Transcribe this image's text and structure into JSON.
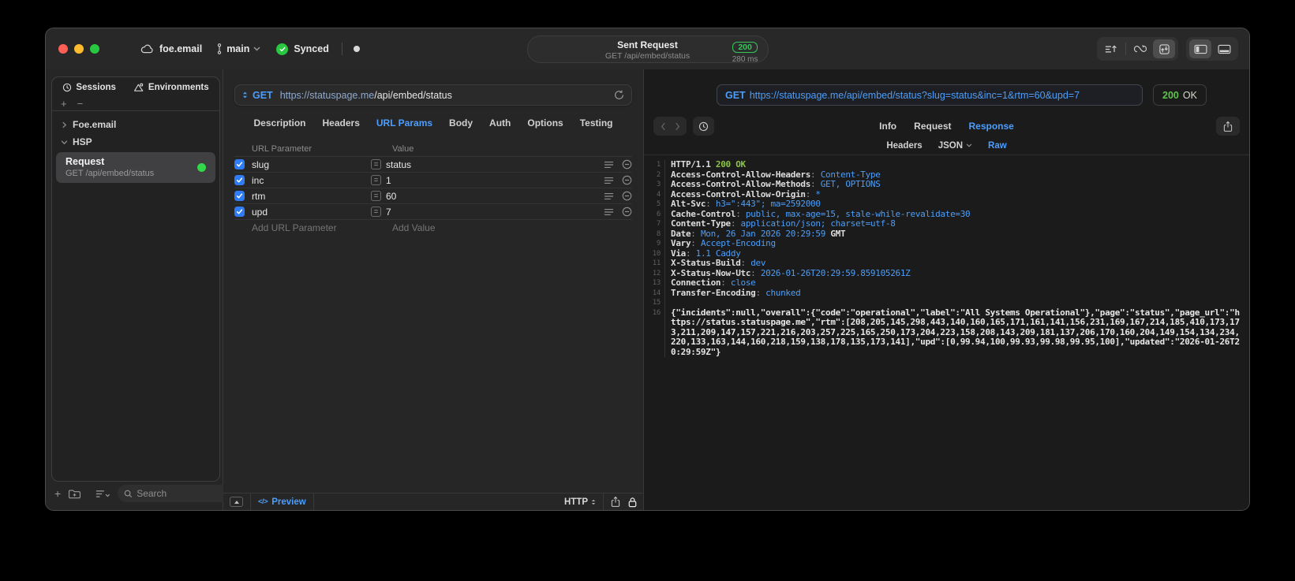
{
  "titlebar": {
    "project": "foe.email",
    "branch": "main",
    "sync_status": "Synced",
    "request_summary": {
      "title": "Sent Request",
      "method_path": "GET /api/embed/status",
      "status_code": "200",
      "duration": "280 ms"
    }
  },
  "sidebar": {
    "tabs": [
      {
        "label": "Sessions"
      },
      {
        "label": "Environments"
      }
    ],
    "groups": [
      {
        "label": "Foe.email",
        "expanded": false
      },
      {
        "label": "HSP",
        "expanded": true
      }
    ],
    "request_item": {
      "title": "Request",
      "subtitle": "GET /api/embed/status",
      "selected": true,
      "status_dot": "green"
    },
    "search_placeholder": "Search"
  },
  "request_pane": {
    "method": "GET",
    "url_domain": "https://statuspage.me",
    "url_path": "/api/embed/status",
    "tabs": [
      "Description",
      "Headers",
      "URL Params",
      "Body",
      "Auth",
      "Options",
      "Testing"
    ],
    "active_tab": "URL Params",
    "params_table": {
      "columns": [
        "URL Parameter",
        "Value"
      ],
      "rows": [
        {
          "enabled": true,
          "name": "slug",
          "value": "status"
        },
        {
          "enabled": true,
          "name": "inc",
          "value": "1"
        },
        {
          "enabled": true,
          "name": "rtm",
          "value": "60"
        },
        {
          "enabled": true,
          "name": "upd",
          "value": "7"
        }
      ],
      "add_name_placeholder": "Add URL Parameter",
      "add_value_placeholder": "Add Value"
    },
    "footer": {
      "preview_label": "Preview",
      "protocol": "HTTP"
    }
  },
  "response_pane": {
    "request_line": {
      "method": "GET",
      "url": "https://statuspage.me/api/embed/status?slug=status&inc=1&rtm=60&upd=7"
    },
    "status": {
      "code": "200",
      "text": "OK"
    },
    "tabs": [
      "Info",
      "Request",
      "Response"
    ],
    "active_tab": "Response",
    "view_tabs": [
      "Headers",
      "JSON",
      "Raw"
    ],
    "active_view_tab": "Raw",
    "lines": [
      {
        "num": 1,
        "segments": [
          [
            "HTTP/1.1 ",
            "key"
          ],
          [
            "200 OK",
            "green"
          ]
        ]
      },
      {
        "num": 2,
        "segments": [
          [
            "Access-Control-Allow-Headers",
            "key"
          ],
          [
            ": ",
            "colon"
          ],
          [
            "Content-Type",
            "val"
          ]
        ]
      },
      {
        "num": 3,
        "segments": [
          [
            "Access-Control-Allow-Methods",
            "key"
          ],
          [
            ": ",
            "colon"
          ],
          [
            "GET, OPTIONS",
            "val"
          ]
        ]
      },
      {
        "num": 4,
        "segments": [
          [
            "Access-Control-Allow-Origin",
            "key"
          ],
          [
            ": ",
            "colon"
          ],
          [
            "*",
            "val"
          ]
        ]
      },
      {
        "num": 5,
        "segments": [
          [
            "Alt-Svc",
            "key"
          ],
          [
            ": ",
            "colon"
          ],
          [
            "h3=\":443\"; ma=2592000",
            "val"
          ]
        ]
      },
      {
        "num": 6,
        "segments": [
          [
            "Cache-Control",
            "key"
          ],
          [
            ": ",
            "colon"
          ],
          [
            "public, max-age=15, stale-while-revalidate=30",
            "val"
          ]
        ]
      },
      {
        "num": 7,
        "segments": [
          [
            "Content-Type",
            "key"
          ],
          [
            ": ",
            "colon"
          ],
          [
            "application/json; charset=utf-8",
            "val"
          ]
        ]
      },
      {
        "num": 8,
        "segments": [
          [
            "Date",
            "key"
          ],
          [
            ": ",
            "colon"
          ],
          [
            "Mon, 26 Jan 2026 20:29:59 ",
            "val"
          ],
          [
            "GMT",
            "key"
          ]
        ]
      },
      {
        "num": 9,
        "segments": [
          [
            "Vary",
            "key"
          ],
          [
            ": ",
            "colon"
          ],
          [
            "Accept-Encoding",
            "val"
          ]
        ]
      },
      {
        "num": 10,
        "segments": [
          [
            "Via",
            "key"
          ],
          [
            ": ",
            "colon"
          ],
          [
            "1.1 Caddy",
            "val"
          ]
        ]
      },
      {
        "num": 11,
        "segments": [
          [
            "X-Status-Build",
            "key"
          ],
          [
            ": ",
            "colon"
          ],
          [
            "dev",
            "val"
          ]
        ]
      },
      {
        "num": 12,
        "segments": [
          [
            "X-Status-Now-Utc",
            "key"
          ],
          [
            ": ",
            "colon"
          ],
          [
            "2026-01-26T20:29:59.859105261Z",
            "val"
          ]
        ]
      },
      {
        "num": 13,
        "segments": [
          [
            "Connection",
            "key"
          ],
          [
            ": ",
            "colon"
          ],
          [
            "close",
            "val"
          ]
        ]
      },
      {
        "num": 14,
        "segments": [
          [
            "Transfer-Encoding",
            "key"
          ],
          [
            ": ",
            "colon"
          ],
          [
            "chunked",
            "val"
          ]
        ]
      },
      {
        "num": 15,
        "segments": []
      },
      {
        "num": 16,
        "segments": [
          [
            "{\"incidents\":null,\"overall\":{\"code\":\"operational\",\"label\":\"All Systems Operational\"},\"page\":\"status\",\"page_url\":\"https://status.statuspage.me\",\"rtm\":[208,205,145,298,443,140,160,165,171,161,141,156,231,169,167,214,185,410,173,173,211,209,147,157,221,216,203,257,225,165,250,173,204,223,158,208,143,209,181,137,206,170,160,204,149,154,134,234,220,133,163,144,160,218,159,138,178,135,173,141],\"upd\":[0,99.94,100,99.93,99.98,99.95,100],\"updated\":\"2026-01-26T20:29:59Z\"}",
            "json"
          ]
        ]
      }
    ]
  },
  "colors": {
    "accent_blue": "#4b9eff",
    "status_green": "#34c759",
    "response_value_blue": "#4d9ef8",
    "response_green": "#8bc34a",
    "checkbox_blue": "#2f7cf7"
  },
  "icons": {
    "cloud-icon": "cloud outline",
    "branch-icon": "git branch",
    "synced-check-icon": "green circle check",
    "sessions-clock-icon": "clock",
    "environments-icon": "prism with node",
    "search-icon": "magnifier",
    "reload-icon": "circular arrow",
    "equals-icon": "= in box",
    "remove-row-icon": "minus in circle",
    "share-icon": "box with up arrow",
    "lock-icon": "padlock"
  }
}
